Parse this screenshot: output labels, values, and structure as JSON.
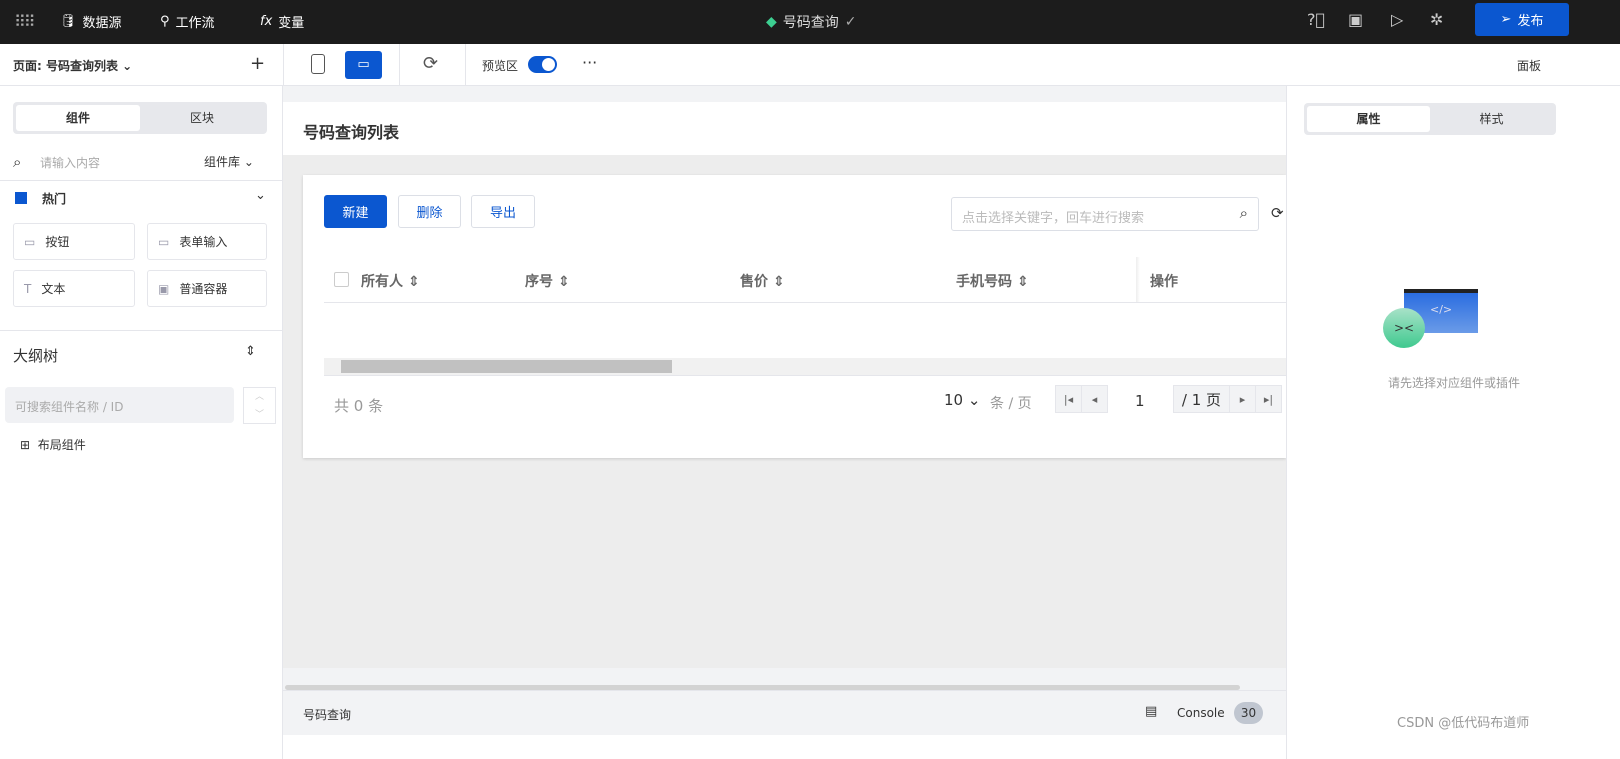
{
  "topbar": {
    "datasource": "数据源",
    "workflow": "工作流",
    "variable": "变量",
    "app_title": "号码查询",
    "publish": "发布"
  },
  "toolbar": {
    "page_label": "页面: 号码查询列表",
    "preview": "预览区",
    "panel": "面板",
    "preview_on": true
  },
  "left": {
    "tabs": [
      "组件",
      "区块"
    ],
    "search_placeholder": "请输入内容",
    "library": "组件库",
    "group": "热门",
    "components": [
      "按钮",
      "表单输入",
      "文本",
      "普通容器"
    ],
    "outline_title": "大纲树",
    "outline_placeholder": "可搜索组件名称 / ID",
    "outline_item": "布局组件"
  },
  "canvas": {
    "page_title": "号码查询列表",
    "buttons": {
      "new": "新建",
      "delete": "删除",
      "export": "导出"
    },
    "search_placeholder": "点击选择关键字，回车进行搜索",
    "columns": [
      "所有人",
      "序号",
      "售价",
      "手机号码",
      "操作"
    ],
    "total": "共 0 条",
    "page_size": "10",
    "per_page": "条 / 页",
    "current_page": "1",
    "page_total": "/ 1 页"
  },
  "footer": {
    "page_name": "号码查询",
    "console": "Console",
    "console_count": "30"
  },
  "right": {
    "tabs": [
      "属性",
      "样式"
    ],
    "empty_text": "请先选择对应组件或插件"
  },
  "watermark": "CSDN @低代码布道师"
}
